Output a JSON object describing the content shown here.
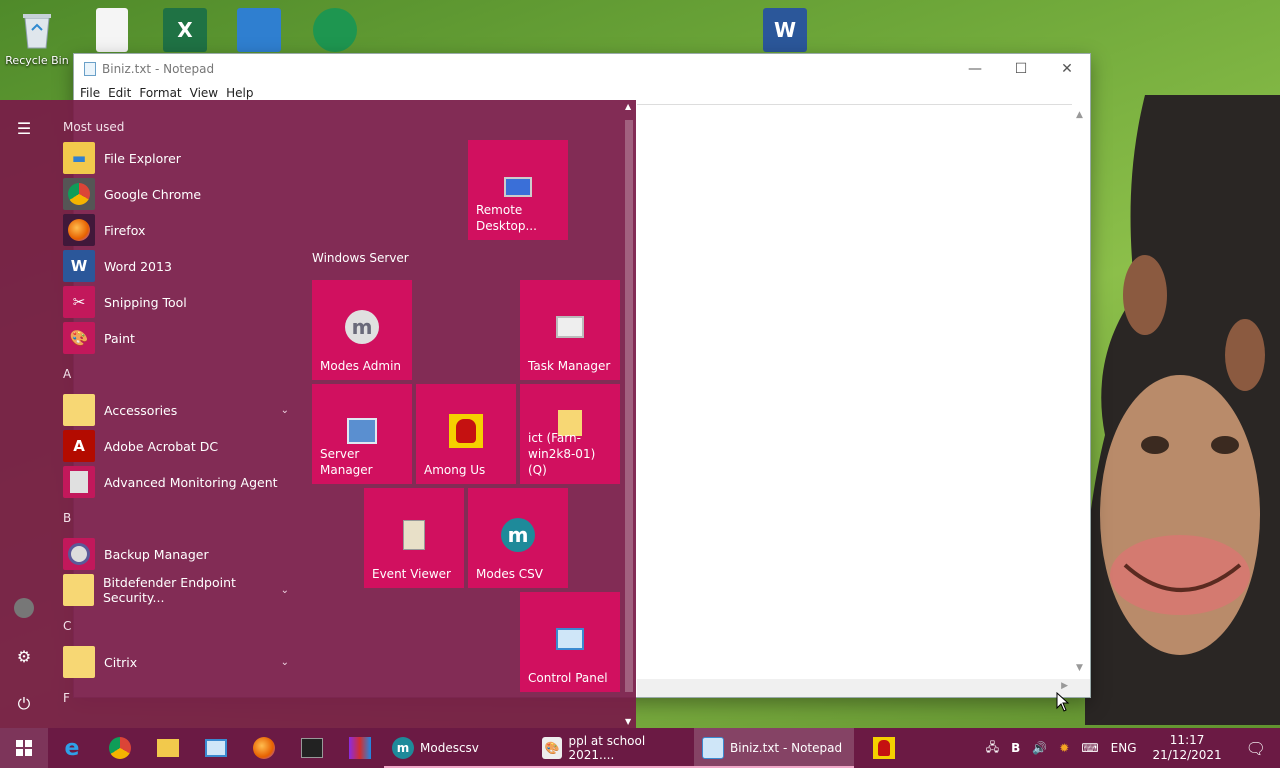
{
  "desktop": {
    "icons": [
      {
        "label": "Recycle Bin"
      },
      {
        "label": ""
      },
      {
        "label": ""
      },
      {
        "label": ""
      },
      {
        "label": ""
      },
      {
        "label": ""
      }
    ]
  },
  "notepad": {
    "title": "Biniz.txt - Notepad",
    "menu": [
      "File",
      "Edit",
      "Format",
      "View",
      "Help"
    ],
    "controls": {
      "minimize": "—",
      "maximize": "☐",
      "close": "✕"
    }
  },
  "start_menu": {
    "most_used_label": "Most used",
    "most_used": [
      {
        "label": "File Explorer",
        "icon": "folder-icon",
        "color": "#f2c94c"
      },
      {
        "label": "Google Chrome",
        "icon": "chrome-icon",
        "color": "#3a7bd5"
      },
      {
        "label": "Firefox",
        "icon": "firefox-icon",
        "color": "#e66000"
      },
      {
        "label": "Word 2013",
        "icon": "word-icon",
        "color": "#2b579a"
      },
      {
        "label": "Snipping Tool",
        "icon": "scissors-icon",
        "color": "#c2185b"
      },
      {
        "label": "Paint",
        "icon": "palette-icon",
        "color": "#4caf50"
      }
    ],
    "groups": [
      {
        "letter": "A",
        "apps": [
          {
            "label": "Accessories",
            "icon": "folder-icon",
            "color": "#f7d774",
            "expand": true
          },
          {
            "label": "Adobe Acrobat DC",
            "icon": "acrobat-icon",
            "color": "#b30b00",
            "expand": false
          },
          {
            "label": "Advanced Monitoring Agent",
            "icon": "monitor-agent-icon",
            "color": "#e0e0e0",
            "expand": false
          }
        ]
      },
      {
        "letter": "B",
        "apps": [
          {
            "label": "Backup Manager",
            "icon": "backup-icon",
            "color": "#5a5a9a",
            "expand": false
          },
          {
            "label": "Bitdefender Endpoint Security...",
            "icon": "folder-icon",
            "color": "#f7d774",
            "expand": true
          }
        ]
      },
      {
        "letter": "C",
        "apps": [
          {
            "label": "Citrix",
            "icon": "folder-icon",
            "color": "#f7d774",
            "expand": true
          }
        ]
      },
      {
        "letter": "F",
        "apps": []
      }
    ],
    "tiles_heading": "Windows Server",
    "tiles": {
      "remote_desktop": "Remote Desktop...",
      "modes_admin": "Modes Admin",
      "task_manager": "Task Manager",
      "server_manager": "Server Manager",
      "among_us": "Among Us",
      "ict": "ict (Farn-win2k8-01) (Q)",
      "event_viewer": "Event Viewer",
      "modes_csv": "Modes CSV",
      "control_panel": "Control Panel"
    },
    "tile_color": "#d1105f"
  },
  "taskbar": {
    "apps": [
      {
        "label": "Modescsv",
        "icon": "modes-icon"
      },
      {
        "label": "ppl at school 2021....",
        "icon": "paint-icon"
      },
      {
        "label": "Biniz.txt - Notepad",
        "icon": "notepad-icon"
      }
    ],
    "tray": {
      "input": "B",
      "language": "ENG",
      "time": "11:17",
      "date": "21/12/2021"
    },
    "color": "#6b1a44"
  }
}
